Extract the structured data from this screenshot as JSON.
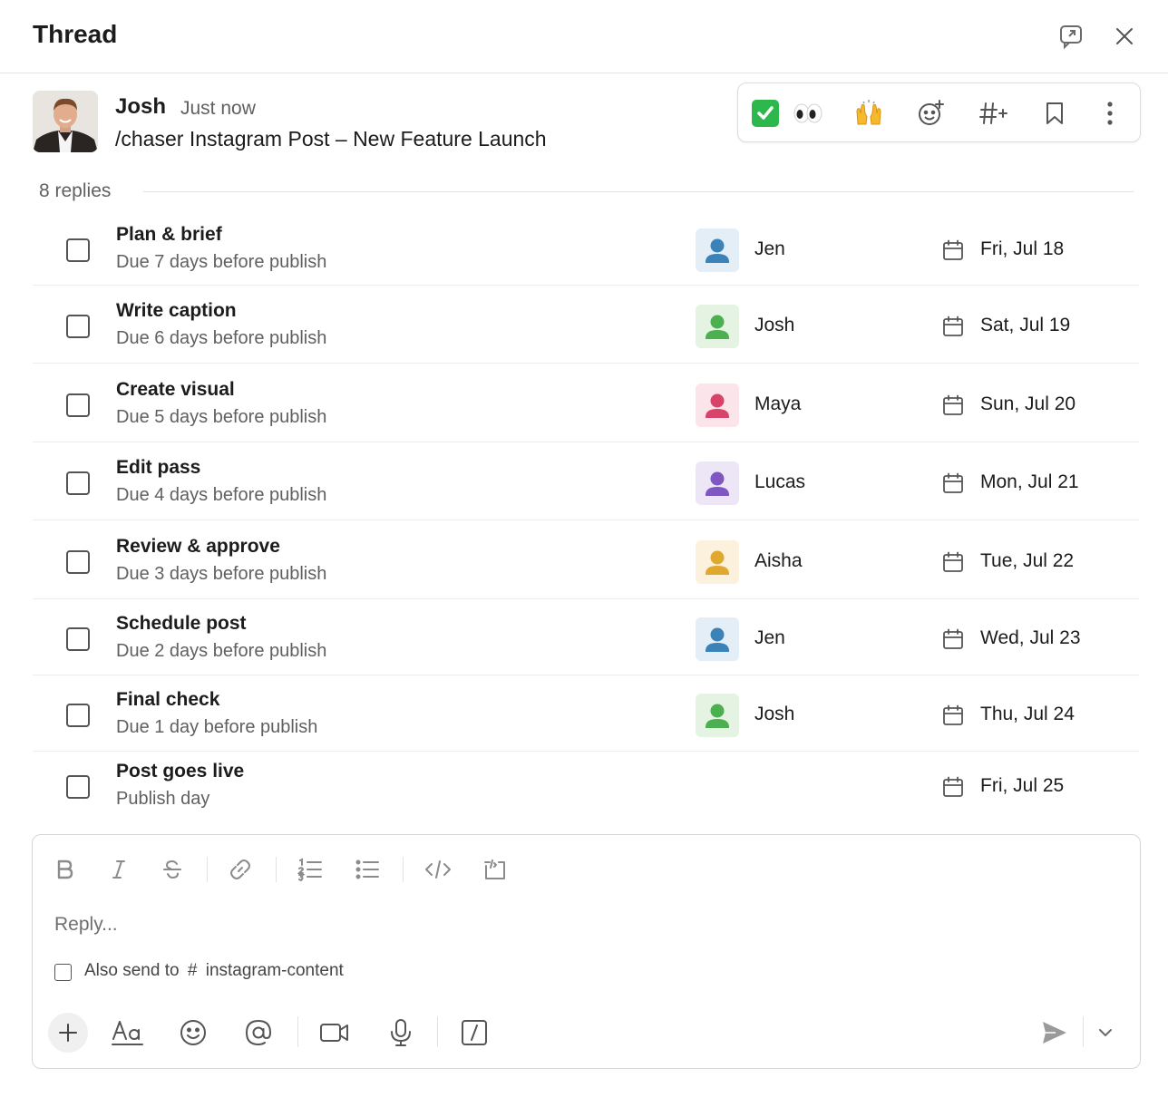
{
  "header": {
    "title": "Thread",
    "open_in_window_icon": "open-in-window-icon",
    "close_icon": "close-icon"
  },
  "message": {
    "author": "Josh",
    "time": "Just now",
    "command": "/chaser",
    "text": " Instagram Post – New Feature Launch",
    "reactions": [
      "✅",
      "👀",
      "🙌"
    ],
    "action_icons": [
      "add-reaction-icon",
      "add-channel-icon",
      "bookmark-icon",
      "more-vertical-icon"
    ]
  },
  "replies": {
    "label": "8 replies"
  },
  "tasks": [
    {
      "title": "Plan & brief",
      "subtitle": "Due 7 days before publish",
      "assignee": "Jen",
      "color": "#3b82b8",
      "bg": "#e3eef7",
      "date": "Fri, Jul 18"
    },
    {
      "title": "Write caption",
      "subtitle": "Due 6 days before publish",
      "assignee": "Josh",
      "color": "#4caf50",
      "bg": "#e5f3e3",
      "date": "Sat, Jul 19"
    },
    {
      "title": "Create visual",
      "subtitle": "Due 5 days before publish",
      "assignee": "Maya",
      "color": "#d8436a",
      "bg": "#fbe4ea",
      "date": "Sun, Jul 20"
    },
    {
      "title": "Edit pass",
      "subtitle": "Due 4 days before publish",
      "assignee": "Lucas",
      "color": "#7e57c2",
      "bg": "#ece6f6",
      "date": "Mon, Jul 21"
    },
    {
      "title": "Review & approve",
      "subtitle": "Due 3 days before publish",
      "assignee": "Aisha",
      "color": "#e0a82e",
      "bg": "#fcf1dc",
      "date": "Tue, Jul 22"
    },
    {
      "title": "Schedule post",
      "subtitle": "Due 2 days before publish",
      "assignee": "Jen",
      "color": "#3b82b8",
      "bg": "#e3eef7",
      "date": "Wed, Jul 23"
    },
    {
      "title": "Final check",
      "subtitle": "Due 1 day before publish",
      "assignee": "Josh",
      "color": "#4caf50",
      "bg": "#e5f3e3",
      "date": "Thu, Jul 24"
    },
    {
      "title": "Post goes live",
      "subtitle": "Publish day",
      "assignee": "",
      "color": "",
      "bg": "",
      "date": "Fri, Jul 25"
    }
  ],
  "composer": {
    "placeholder": "Reply...",
    "also_send_prefix": "Also send to",
    "channel_hash": "#",
    "channel": "instagram-content",
    "format_icons": [
      "bold-icon",
      "italic-icon",
      "strikethrough-icon",
      "link-icon",
      "ordered-list-icon",
      "bulleted-list-icon",
      "code-icon",
      "code-block-icon"
    ],
    "bottom_icons": [
      "plus-icon",
      "formatting-icon",
      "emoji-icon",
      "mention-icon",
      "video-icon",
      "microphone-icon",
      "slash-command-icon",
      "send-icon",
      "send-options-chevron-icon"
    ]
  }
}
